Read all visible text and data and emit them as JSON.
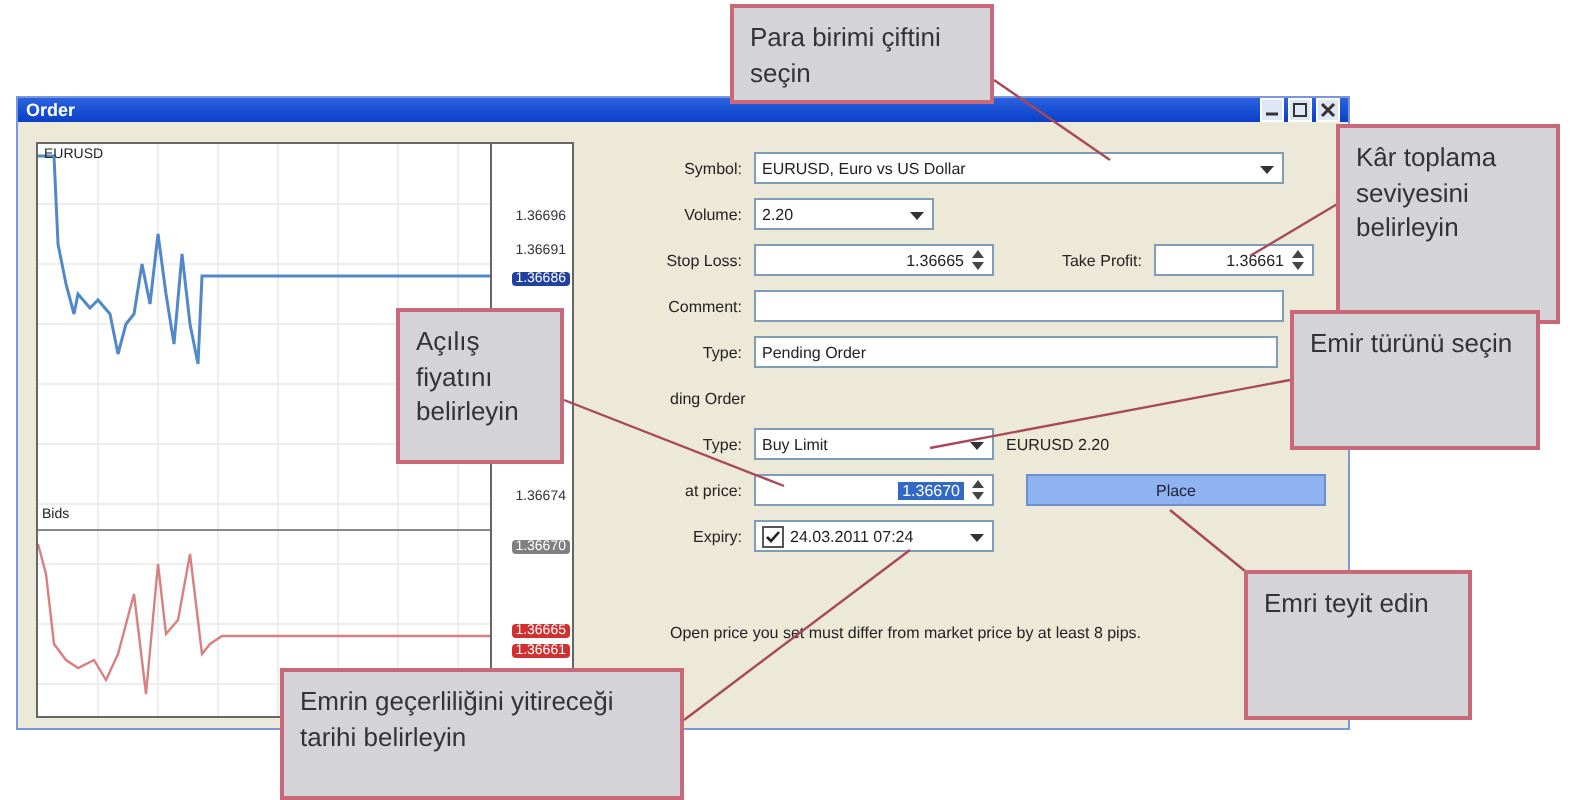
{
  "window": {
    "title": "Order"
  },
  "chart": {
    "symbol": "EURUSD",
    "indicator": "Bids",
    "price_labels": [
      {
        "text": "1.36696",
        "kind": "plain"
      },
      {
        "text": "1.36691",
        "kind": "plain"
      },
      {
        "text": "1.36686",
        "kind": "blue"
      },
      {
        "text": "1.36674",
        "kind": "plain"
      },
      {
        "text": "1.36670",
        "kind": "gray"
      },
      {
        "text": "1.36665",
        "kind": "red"
      },
      {
        "text": "1.36661",
        "kind": "red"
      }
    ]
  },
  "form": {
    "symbol": {
      "label": "Symbol:",
      "value": "EURUSD, Euro vs US Dollar"
    },
    "volume": {
      "label": "Volume:",
      "value": "2.20"
    },
    "stop_loss": {
      "label": "Stop Loss:",
      "value": "1.36665"
    },
    "take_profit": {
      "label": "Take Profit:",
      "value": "1.36661"
    },
    "comment": {
      "label": "Comment:"
    },
    "type": {
      "label": "Type:",
      "value": "Pending Order"
    },
    "section": "ding Order",
    "pending_type": {
      "label": "Type:",
      "value": "Buy Limit",
      "info": "EURUSD 2.20"
    },
    "at_price": {
      "label": "at price:",
      "value": "1.36670"
    },
    "place_button": "Place",
    "expiry": {
      "label": "Expiry:",
      "checked": true,
      "value": "24.03.2011 07:24"
    },
    "note": "Open price you set must differ from market price by at least 8 pips."
  },
  "callouts": [
    {
      "text": "Para birimi çiftini seçin"
    },
    {
      "text": "Kâr toplama seviyesini belirleyin"
    },
    {
      "text": "Açılış fiyatını belirleyin"
    },
    {
      "text": "Emir türünü seçin"
    },
    {
      "text": "Emri teyit edin"
    },
    {
      "text": "Emrin geçerliliğini yitireceği tarihi belirleyin"
    }
  ]
}
